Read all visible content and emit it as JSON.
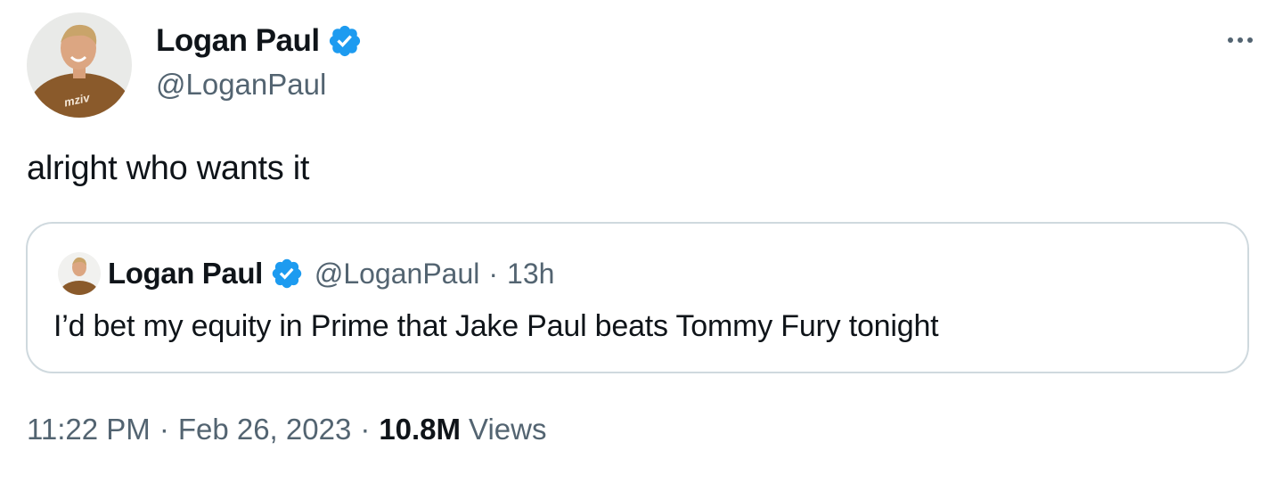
{
  "tweet": {
    "author": {
      "name": "Logan Paul",
      "handle": "@LoganPaul",
      "verified": true,
      "avatar_shirt_text": "mziv"
    },
    "text": "alright who wants it",
    "more_icon": "more-horizontal-icon",
    "quoted": {
      "author": {
        "name": "Logan Paul",
        "handle": "@LoganPaul",
        "verified": true
      },
      "separator": "·",
      "time": "13h",
      "text": "I’d bet my equity in Prime that Jake Paul beats Tommy Fury tonight"
    },
    "meta": {
      "time": "11:22 PM",
      "separator": "·",
      "date": "Feb 26, 2023",
      "views_count": "10.8M",
      "views_label": "Views"
    }
  },
  "colors": {
    "text_primary": "#0f1419",
    "text_secondary": "#536471",
    "verified_blue": "#1d9bf0",
    "border": "#cfd9de",
    "shirt_brown": "#8a5a2b"
  }
}
